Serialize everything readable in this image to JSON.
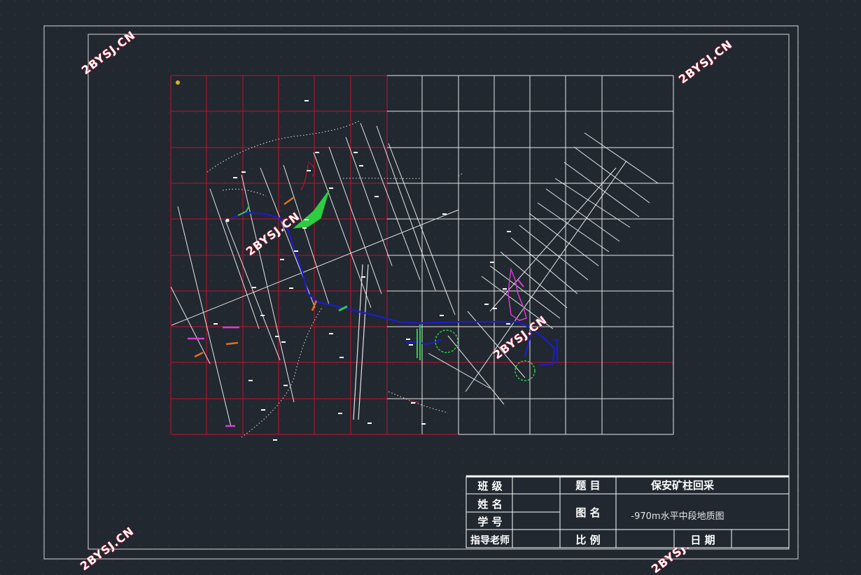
{
  "title_block": {
    "class_label": "班 级",
    "name_label": "姓 名",
    "student_id_label": "学 号",
    "advisor_label": "指导老师",
    "topic_label": "题 目",
    "topic_value": "保安矿柱回采",
    "drawing_name_label": "图 名",
    "drawing_name_value": "-970m水平中段地质图",
    "scale_label": "比 例",
    "date_label": "日 期"
  },
  "watermark": "2BYSJ.CN",
  "colors": {
    "background": "#212830",
    "grid_dots": "#2e3540",
    "frame": "#d9d9d9",
    "red_grid": "#c8102e",
    "white_grid": "#e6e6e6",
    "tunnel_blue": "#1c1ccf",
    "ore_green": "#2ecc40",
    "magenta": "#d63cd6",
    "orange": "#e07020",
    "watermark_fill": "#ffffff",
    "watermark_stroke": "#c8102e"
  }
}
